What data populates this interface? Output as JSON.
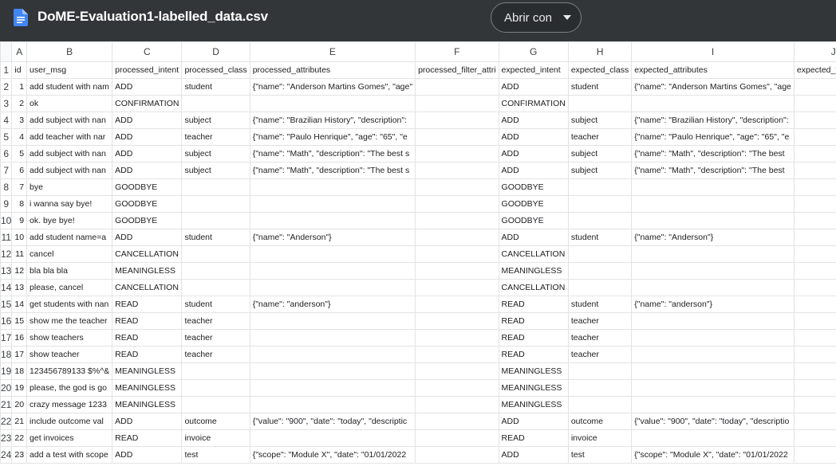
{
  "file": {
    "title": "DoME-Evaluation1-labelled_data.csv",
    "icon": "document-icon",
    "icon_color": "#4285f4"
  },
  "toolbar": {
    "open_with_label": "Abrir con"
  },
  "grid": {
    "column_letters": [
      "A",
      "B",
      "C",
      "D",
      "E",
      "F",
      "G",
      "H",
      "I",
      "J"
    ],
    "row_numbers": [
      "1",
      "2",
      "3",
      "4",
      "5",
      "6",
      "7",
      "8",
      "9",
      "10",
      "11",
      "12",
      "13",
      "14",
      "15",
      "16",
      "17",
      "18",
      "19",
      "20",
      "21",
      "22",
      "23",
      "24"
    ],
    "rows": [
      [
        "id",
        "user_msg",
        "processed_intent",
        "processed_class",
        "processed_attributes",
        "processed_filter_attri",
        "expected_intent",
        "expected_class",
        "expected_attributes",
        "expected_filter_attri"
      ],
      [
        "1",
        "add student with nam",
        "ADD",
        "student",
        "{\"name\": \"Anderson Martins Gomes\", \"age\"",
        "",
        "ADD",
        "student",
        "{\"name\": \"Anderson Martins Gomes\", \"age",
        "",
        ""
      ],
      [
        "2",
        "ok",
        "CONFIRMATION",
        "",
        "",
        "",
        "CONFIRMATION",
        "",
        "",
        ""
      ],
      [
        "3",
        "add subject with nan",
        "ADD",
        "subject",
        "{\"name\": \"Brazilian History\", \"description\":",
        "",
        "ADD",
        "subject",
        "{\"name\": \"Brazilian History\", \"description\":",
        ""
      ],
      [
        "4",
        "add teacher with nar",
        "ADD",
        "teacher",
        "{\"name\": \"Paulo Henrique\", \"age\": \"65\", \"e",
        "",
        "ADD",
        "teacher",
        "{\"name\": \"Paulo Henrique\", \"age\": \"65\", \"e",
        ""
      ],
      [
        "5",
        "add subject with nan",
        "ADD",
        "subject",
        "{\"name\": \"Math\", \"description\": \"The best s",
        "",
        "ADD",
        "subject",
        "{\"name\": \"Math\", \"description\": \"The best",
        ""
      ],
      [
        "6",
        "add subject with nan",
        "ADD",
        "subject",
        "{\"name\": \"Math\", \"description\": \"The best s",
        "",
        "ADD",
        "subject",
        "{\"name\": \"Math\", \"description\": \"The best",
        ""
      ],
      [
        "7",
        "bye",
        "GOODBYE",
        "",
        "",
        "",
        "GOODBYE",
        "",
        "",
        ""
      ],
      [
        "8",
        "i wanna say bye!",
        "GOODBYE",
        "",
        "",
        "",
        "GOODBYE",
        "",
        "",
        ""
      ],
      [
        "9",
        "ok. bye bye!",
        "GOODBYE",
        "",
        "",
        "",
        "GOODBYE",
        "",
        "",
        ""
      ],
      [
        "10",
        "add student name=a",
        "ADD",
        "student",
        "{\"name\": \"Anderson\"}",
        "",
        "ADD",
        "student",
        "{\"name\": \"Anderson\"}",
        ""
      ],
      [
        "11",
        "cancel",
        "CANCELLATION",
        "",
        "",
        "",
        "CANCELLATION",
        "",
        "",
        ""
      ],
      [
        "12",
        "bla bla bla",
        "MEANINGLESS",
        "",
        "",
        "",
        "MEANINGLESS",
        "",
        "",
        ""
      ],
      [
        "13",
        "please, cancel",
        "CANCELLATION",
        "",
        "",
        "",
        "CANCELLATION",
        "",
        "",
        ""
      ],
      [
        "14",
        "get students with nan",
        "READ",
        "student",
        "{\"name\": \"anderson\"}",
        "",
        "READ",
        "student",
        "{\"name\": \"anderson\"}",
        ""
      ],
      [
        "15",
        "show me the teacher",
        "READ",
        "teacher",
        "",
        "",
        "READ",
        "teacher",
        "",
        ""
      ],
      [
        "16",
        "show teachers",
        "READ",
        "teacher",
        "",
        "",
        "READ",
        "teacher",
        "",
        ""
      ],
      [
        "17",
        "show teacher",
        "READ",
        "teacher",
        "",
        "",
        "READ",
        "teacher",
        "",
        ""
      ],
      [
        "18",
        "123456789133 $%^&",
        "MEANINGLESS",
        "",
        "",
        "",
        "MEANINGLESS",
        "",
        "",
        ""
      ],
      [
        "19",
        "please, the god is go",
        "MEANINGLESS",
        "",
        "",
        "",
        "MEANINGLESS",
        "",
        "",
        ""
      ],
      [
        "20",
        "crazy message 1233",
        "MEANINGLESS",
        "",
        "",
        "",
        "MEANINGLESS",
        "",
        "",
        ""
      ],
      [
        "21",
        "include outcome val",
        "ADD",
        "outcome",
        "{\"value\": \"900\", \"date\": \"today\", \"descriptic",
        "",
        "ADD",
        "outcome",
        "{\"value\": \"900\", \"date\": \"today\", \"descriptio",
        ""
      ],
      [
        "22",
        "get invoices",
        "READ",
        "invoice",
        "",
        "",
        "READ",
        "invoice",
        "",
        ""
      ],
      [
        "23",
        "add a test with scope",
        "ADD",
        "test",
        "{\"scope\": \"Module X\", \"date\": \"01/01/2022",
        "",
        "ADD",
        "test",
        "{\"scope\": \"Module X\", \"date\": \"01/01/2022",
        ""
      ]
    ]
  }
}
